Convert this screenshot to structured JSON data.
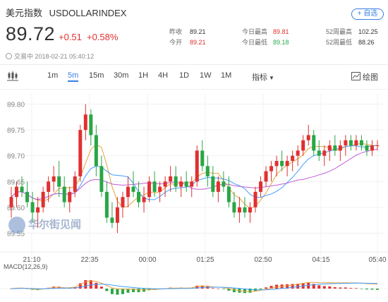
{
  "header": {
    "name_cn": "美元指数",
    "symbol": "USDOLLARINDEX",
    "add_button": "+ 自选"
  },
  "quote": {
    "price": "89.72",
    "change": "+0.51",
    "change_pct": "+0.58%"
  },
  "stats": {
    "prev_close_label": "昨收",
    "prev_close": "89.21",
    "open_label": "今开",
    "open": "89.21",
    "high_label": "今日最高",
    "high": "89.81",
    "low_label": "今日最低",
    "low": "89.18",
    "w52_high_label": "52周最高",
    "w52_high": "102.25",
    "w52_low_label": "52周最低",
    "w52_low": "88.26"
  },
  "status": {
    "text": "交易中 2018-02-21 05:40:12"
  },
  "toolbar": {
    "periods": [
      "1m",
      "5m",
      "15m",
      "30m",
      "1H",
      "4H",
      "1D",
      "1W",
      "1M"
    ],
    "active_period": "5m",
    "indicators": "指标",
    "draw": "绘图"
  },
  "watermark": "华尔街见闻",
  "macd_label": "MACD(12,26,9)",
  "colors": {
    "up": "#e03030",
    "down": "#28a745",
    "accent": "#3a7ee6"
  },
  "chart_data": {
    "type": "candlestick",
    "y_ticks": [
      "89.80",
      "89.75",
      "89.70",
      "89.65",
      "89.60",
      "89.55"
    ],
    "ylim": [
      89.53,
      89.82
    ],
    "x_ticks": [
      "21:10",
      "22:35",
      "00:00",
      "01:25",
      "02:50",
      "04:15",
      "05:40"
    ],
    "candles": [
      [
        89.6,
        89.64,
        89.58,
        89.62
      ],
      [
        89.62,
        89.65,
        89.6,
        89.64
      ],
      [
        89.64,
        89.66,
        89.62,
        89.63
      ],
      [
        89.63,
        89.65,
        89.6,
        89.61
      ],
      [
        89.61,
        89.63,
        89.57,
        89.59
      ],
      [
        89.59,
        89.62,
        89.56,
        89.6
      ],
      [
        89.6,
        89.64,
        89.59,
        89.63
      ],
      [
        89.63,
        89.66,
        89.61,
        89.65
      ],
      [
        89.65,
        89.68,
        89.63,
        89.66
      ],
      [
        89.66,
        89.69,
        89.62,
        89.64
      ],
      [
        89.64,
        89.66,
        89.6,
        89.61
      ],
      [
        89.61,
        89.64,
        89.59,
        89.63
      ],
      [
        89.63,
        89.67,
        89.62,
        89.66
      ],
      [
        89.66,
        89.76,
        89.65,
        89.75
      ],
      [
        89.75,
        89.8,
        89.73,
        89.78
      ],
      [
        89.78,
        89.79,
        89.72,
        89.74
      ],
      [
        89.74,
        89.76,
        89.66,
        89.68
      ],
      [
        89.68,
        89.7,
        89.62,
        89.63
      ],
      [
        89.63,
        89.65,
        89.57,
        89.58
      ],
      [
        89.58,
        89.61,
        89.56,
        89.57
      ],
      [
        89.57,
        89.62,
        89.55,
        89.6
      ],
      [
        89.6,
        89.63,
        89.58,
        89.62
      ],
      [
        89.62,
        89.66,
        89.6,
        89.64
      ],
      [
        89.64,
        89.67,
        89.62,
        89.63
      ],
      [
        89.63,
        89.65,
        89.6,
        89.61
      ],
      [
        89.61,
        89.64,
        89.59,
        89.62
      ],
      [
        89.62,
        89.66,
        89.61,
        89.65
      ],
      [
        89.65,
        89.67,
        89.62,
        89.63
      ],
      [
        89.63,
        89.65,
        89.61,
        89.64
      ],
      [
        89.64,
        89.66,
        89.62,
        89.65
      ],
      [
        89.65,
        89.68,
        89.63,
        89.66
      ],
      [
        89.66,
        89.68,
        89.63,
        89.64
      ],
      [
        89.64,
        89.66,
        89.62,
        89.65
      ],
      [
        89.65,
        89.67,
        89.63,
        89.64
      ],
      [
        89.64,
        89.66,
        89.62,
        89.65
      ],
      [
        89.65,
        89.72,
        89.64,
        89.71
      ],
      [
        89.71,
        89.73,
        89.67,
        89.68
      ],
      [
        89.68,
        89.7,
        89.64,
        89.66
      ],
      [
        89.66,
        89.68,
        89.62,
        89.63
      ],
      [
        89.63,
        89.66,
        89.61,
        89.65
      ],
      [
        89.65,
        89.67,
        89.63,
        89.64
      ],
      [
        89.64,
        89.66,
        89.6,
        89.61
      ],
      [
        89.61,
        89.63,
        89.58,
        89.59
      ],
      [
        89.59,
        89.62,
        89.57,
        89.6
      ],
      [
        89.6,
        89.62,
        89.58,
        89.59
      ],
      [
        89.59,
        89.61,
        89.57,
        89.6
      ],
      [
        89.6,
        89.64,
        89.59,
        89.63
      ],
      [
        89.63,
        89.66,
        89.62,
        89.65
      ],
      [
        89.65,
        89.68,
        89.64,
        89.67
      ],
      [
        89.67,
        89.69,
        89.65,
        89.68
      ],
      [
        89.68,
        89.7,
        89.66,
        89.69
      ],
      [
        89.69,
        89.71,
        89.67,
        89.68
      ],
      [
        89.68,
        89.7,
        89.66,
        89.69
      ],
      [
        89.69,
        89.71,
        89.67,
        89.7
      ],
      [
        89.7,
        89.72,
        89.68,
        89.71
      ],
      [
        89.71,
        89.74,
        89.7,
        89.73
      ],
      [
        89.73,
        89.76,
        89.72,
        89.74
      ],
      [
        89.74,
        89.75,
        89.7,
        89.71
      ],
      [
        89.71,
        89.73,
        89.69,
        89.7
      ],
      [
        89.7,
        89.72,
        89.68,
        89.71
      ],
      [
        89.71,
        89.73,
        89.69,
        89.72
      ],
      [
        89.72,
        89.74,
        89.7,
        89.71
      ],
      [
        89.71,
        89.73,
        89.69,
        89.72
      ],
      [
        89.72,
        89.74,
        89.7,
        89.73
      ],
      [
        89.73,
        89.74,
        89.71,
        89.72
      ],
      [
        89.72,
        89.74,
        89.71,
        89.73
      ],
      [
        89.73,
        89.74,
        89.71,
        89.72
      ],
      [
        89.72,
        89.73,
        89.7,
        89.71
      ],
      [
        89.71,
        89.73,
        89.7,
        89.72
      ],
      [
        89.72,
        89.73,
        89.71,
        89.72
      ]
    ]
  }
}
